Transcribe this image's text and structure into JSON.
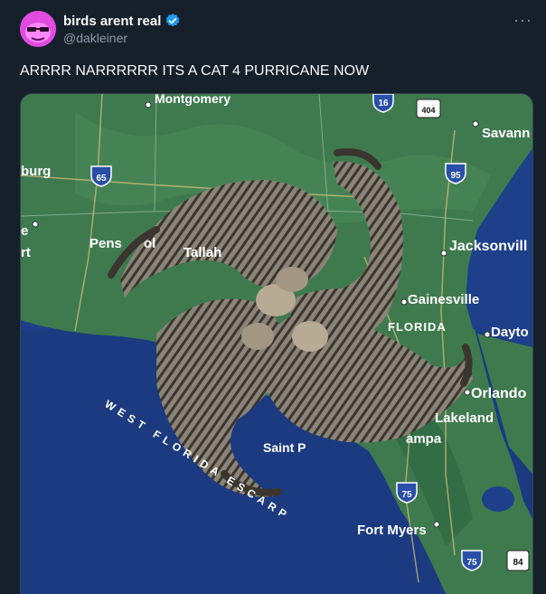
{
  "author": {
    "display_name": "birds arent real",
    "handle": "@dakleiner",
    "avatar_icon": "magenta-face-avatar",
    "verified_icon": "verified-badge-icon"
  },
  "more_label": "···",
  "tweet": {
    "text": "ARRRR NARRRRRR ITS A CAT 4 PURRICANE NOW"
  },
  "map": {
    "labels": {
      "montgomery": "Montgomery",
      "savannah": "Savann",
      "burg": "burg",
      "jacksonville": "Jacksonvill",
      "pensacola": "Pens",
      "pensacola_tail": "ol",
      "tallahassee": "Tallah",
      "gainesville": "Gainesville",
      "florida": "FLORIDA",
      "daytona": "Dayto",
      "orlando": "Orlando",
      "lakeland": "Lakeland",
      "tampa": "ampa",
      "saint_pete": "Saint P",
      "fort_myers": "Fort Myers",
      "west_florida_escarpment": "WEST FLORIDA ESCARP",
      "left_e": "e",
      "left_rt": "rt"
    },
    "shields": {
      "i65": "65",
      "i16": "16",
      "us404": "404",
      "i95": "95",
      "i75_north": "75",
      "i75_south": "75",
      "us84": "84"
    }
  },
  "colors": {
    "background": "#15202b",
    "gulf": "#1e3f8a",
    "land": "#3f7a4f",
    "accent": "#1d9bf0"
  }
}
